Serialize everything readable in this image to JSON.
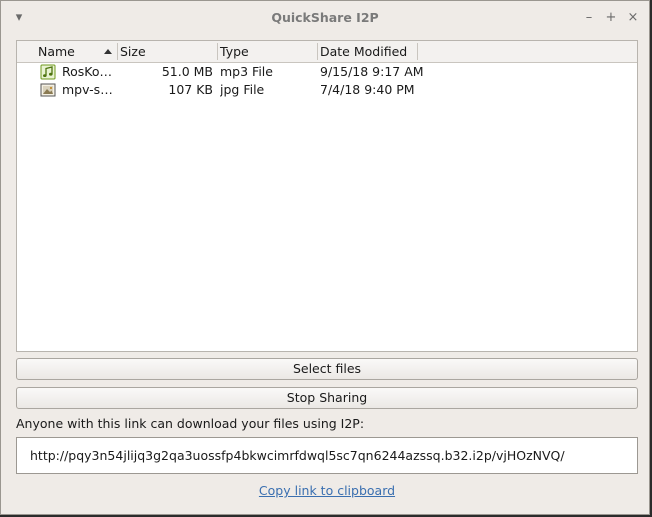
{
  "window": {
    "title": "QuickShare I2P",
    "menu_glyph": "▾",
    "minimize_glyph": "–",
    "maximize_glyph": "+",
    "close_glyph": "×"
  },
  "table": {
    "columns": [
      "Name",
      "Size",
      "Type",
      "Date Modified"
    ],
    "sort_column": "Name",
    "sort_direction": "ascending",
    "rows": [
      {
        "icon": "music-file-icon",
        "name": "RosKo…",
        "size": "51.0 MB",
        "type": "mp3 File",
        "date": "9/15/18 9:17 AM"
      },
      {
        "icon": "image-file-icon",
        "name": "mpv-s…",
        "size": "107 KB",
        "type": "jpg File",
        "date": "7/4/18 9:40 PM"
      }
    ]
  },
  "buttons": {
    "select_files": "Select files",
    "stop_sharing": "Stop Sharing"
  },
  "info_text": "Anyone with this link can download your files using I2P:",
  "share_link": "http://pqy3n54jlijq3g2qa3uossfp4bkwcimrfdwql5sc7qn6244azssq.b32.i2p/vjHOzNVQ/",
  "copy_link_label": "Copy link to clipboard",
  "colors": {
    "window_bg": "#efebe7",
    "link": "#3a6fb0",
    "music_icon": "#6f9a1e"
  }
}
